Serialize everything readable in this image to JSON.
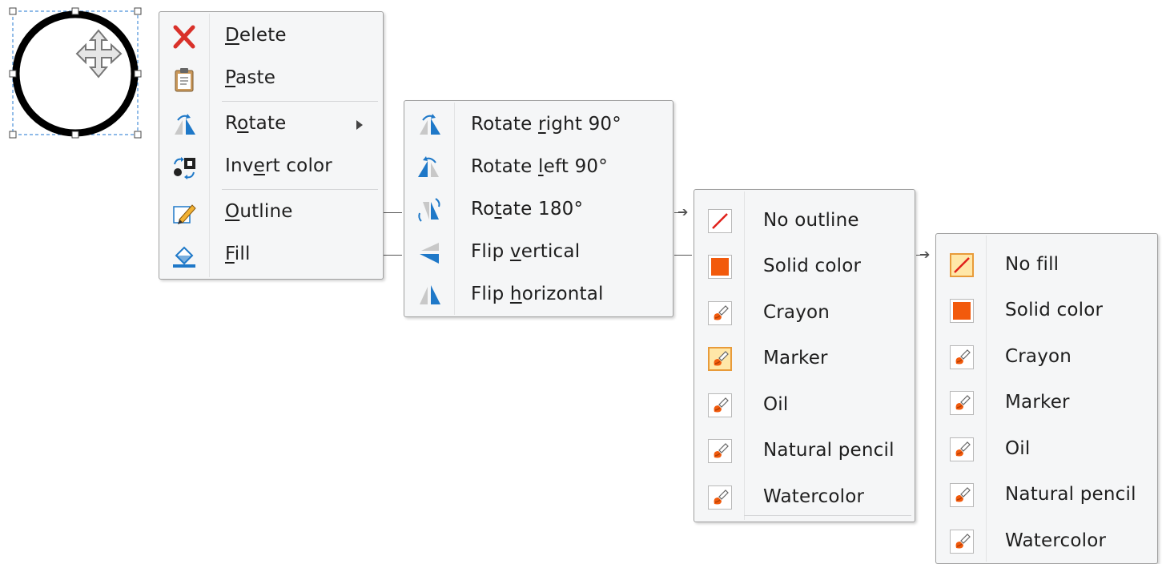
{
  "context_menu": {
    "items": [
      {
        "pre": "",
        "ul": "D",
        "post": "elete",
        "icon": "delete-x-icon"
      },
      {
        "pre": "",
        "ul": "P",
        "post": "aste",
        "icon": "clipboard-icon"
      },
      {
        "pre": "R",
        "ul": "o",
        "post": "tate",
        "icon": "rotate-icon",
        "submenu": true
      },
      {
        "pre": "Inv",
        "ul": "e",
        "post": "rt color",
        "icon": "invert-color-icon"
      },
      {
        "pre": "",
        "ul": "O",
        "post": "utline",
        "icon": "pencil-icon"
      },
      {
        "pre": "",
        "ul": "F",
        "post": "ill",
        "icon": "fill-bucket-icon"
      }
    ]
  },
  "rotate_menu": {
    "items": [
      {
        "pre": "Rotate ",
        "ul": "r",
        "post": "ight 90°",
        "icon": "rotate-right-icon"
      },
      {
        "pre": "Rotate ",
        "ul": "l",
        "post": "eft 90°",
        "icon": "rotate-left-icon"
      },
      {
        "pre": "Ro",
        "ul": "t",
        "post": "ate 180°",
        "icon": "rotate-180-icon"
      },
      {
        "pre": "Flip ",
        "ul": "v",
        "post": "ertical",
        "icon": "flip-vertical-icon"
      },
      {
        "pre": "Flip ",
        "ul": "h",
        "post": "orizontal",
        "icon": "flip-horizontal-icon"
      }
    ]
  },
  "outline_menu": {
    "items": [
      {
        "label": "No outline",
        "kind": "none"
      },
      {
        "label": "Solid color",
        "kind": "solid"
      },
      {
        "label": "Crayon",
        "kind": "brush"
      },
      {
        "label": "Marker",
        "kind": "brush",
        "selected": true
      },
      {
        "label": "Oil",
        "kind": "brush"
      },
      {
        "label": "Natural pencil",
        "kind": "brush"
      },
      {
        "label": "Watercolor",
        "kind": "brush"
      }
    ]
  },
  "fill_menu": {
    "items": [
      {
        "label": "No fill",
        "kind": "none",
        "selected": true
      },
      {
        "label": "Solid color",
        "kind": "solid"
      },
      {
        "label": "Crayon",
        "kind": "brush"
      },
      {
        "label": "Marker",
        "kind": "brush"
      },
      {
        "label": "Oil",
        "kind": "brush"
      },
      {
        "label": "Natural pencil",
        "kind": "brush"
      },
      {
        "label": "Watercolor",
        "kind": "brush"
      }
    ]
  },
  "colors": {
    "accent_orange": "#f25a0c",
    "selected_border": "#e89b3a",
    "selected_bg": "#ffe7a8",
    "icon_blue": "#1e78c8",
    "delete_red": "#d9312a"
  }
}
